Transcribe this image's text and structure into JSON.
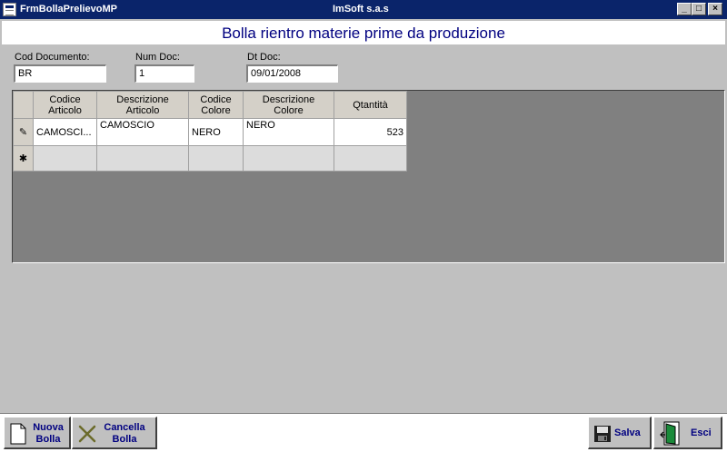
{
  "window": {
    "title": "FrmBollaPrelievoMP",
    "company": "ImSoft s.a.s",
    "min_label": "_",
    "max_label": "□",
    "close_label": "×"
  },
  "page": {
    "title": "Bolla rientro materie prime da produzione"
  },
  "form": {
    "cod_documento": {
      "label": "Cod Documento:",
      "value": "BR"
    },
    "num_doc": {
      "label": "Num Doc:",
      "value": "1"
    },
    "dt_doc": {
      "label": "Dt Doc:",
      "value": "09/01/2008"
    }
  },
  "grid": {
    "columns": [
      {
        "line1": "Codice",
        "line2": "Articolo"
      },
      {
        "line1": "Descrizione",
        "line2": "Articolo"
      },
      {
        "line1": "Codice",
        "line2": "Colore"
      },
      {
        "line1": "Descrizione",
        "line2": "Colore"
      },
      {
        "line1": "Qtantità",
        "line2": ""
      }
    ],
    "rows": [
      {
        "row_marker": "✎",
        "codice_articolo": "CAMOSCI...",
        "descrizione_articolo": "CAMOSCIO",
        "codice_colore": "NERO",
        "descrizione_colore": "NERO",
        "quantita": "523"
      }
    ],
    "new_row_marker": "✱"
  },
  "toolbar": {
    "nuova": {
      "line1": "Nuova",
      "line2": "Bolla",
      "icon": "new-document-icon"
    },
    "cancella": {
      "line1": "Cancella",
      "line2": "Bolla",
      "icon": "delete-x-icon"
    },
    "salva": {
      "label": "Salva",
      "icon": "floppy-disk-icon"
    },
    "esci": {
      "label": "Esci",
      "icon": "exit-door-icon"
    }
  },
  "colors": {
    "titlebar": "#0a246a",
    "page_title": "#000080",
    "button_text": "#000080",
    "grid_background": "#808080"
  }
}
